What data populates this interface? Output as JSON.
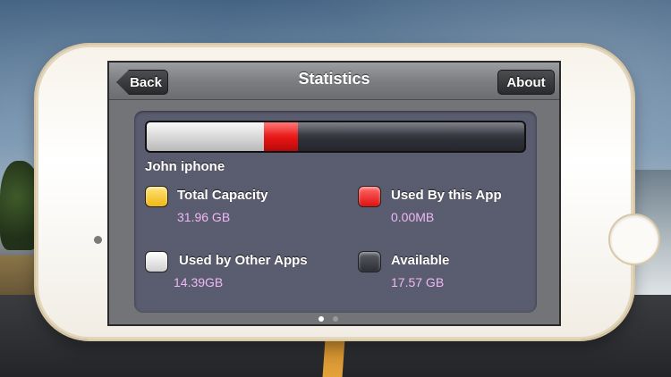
{
  "navbar": {
    "title": "Statistics",
    "back_label": "Back",
    "about_label": "About"
  },
  "device": {
    "name": "John iphone"
  },
  "storage": {
    "total_capacity": {
      "label": "Total Capacity",
      "value": "31.96 GB",
      "color": "#f2c12e"
    },
    "used_by_app": {
      "label": "Used By this App",
      "value": "0.00MB",
      "color": "#e31313"
    },
    "used_by_other": {
      "label": "Used by Other Apps",
      "value": "14.39GB",
      "color": "#e6e6e6"
    },
    "available": {
      "label": "Available",
      "value": "17.57 GB",
      "color": "#3a3c44"
    },
    "bar_fractions": {
      "other": 0.31,
      "app": 0.09
    }
  },
  "pager": {
    "count": 2,
    "active_index": 0
  }
}
